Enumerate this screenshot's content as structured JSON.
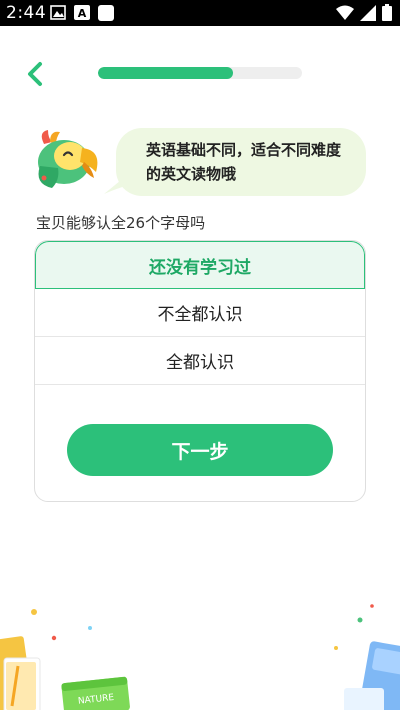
{
  "status_bar": {
    "time": "2:44",
    "icons": [
      "image-icon",
      "a-badge-icon",
      "white-square-icon",
      "wifi-icon",
      "signal-icon",
      "battery-icon"
    ]
  },
  "header": {
    "back_icon": "chevron-left-icon",
    "progress": 0.66,
    "accent_color": "#2cc07a"
  },
  "mascot": {
    "icon": "parrot-mascot-icon",
    "bubble_line1": "英语基础不同，适合不同难度",
    "bubble_line2": "的英文读物哦"
  },
  "question": "宝贝能够认全26个字母吗",
  "options": [
    {
      "label": "还没有学习过",
      "selected": true
    },
    {
      "label": "不全都认识",
      "selected": false
    },
    {
      "label": "全都认识",
      "selected": false
    }
  ],
  "next_button": "下一步",
  "decoration": {
    "book_label": "NATURE"
  }
}
